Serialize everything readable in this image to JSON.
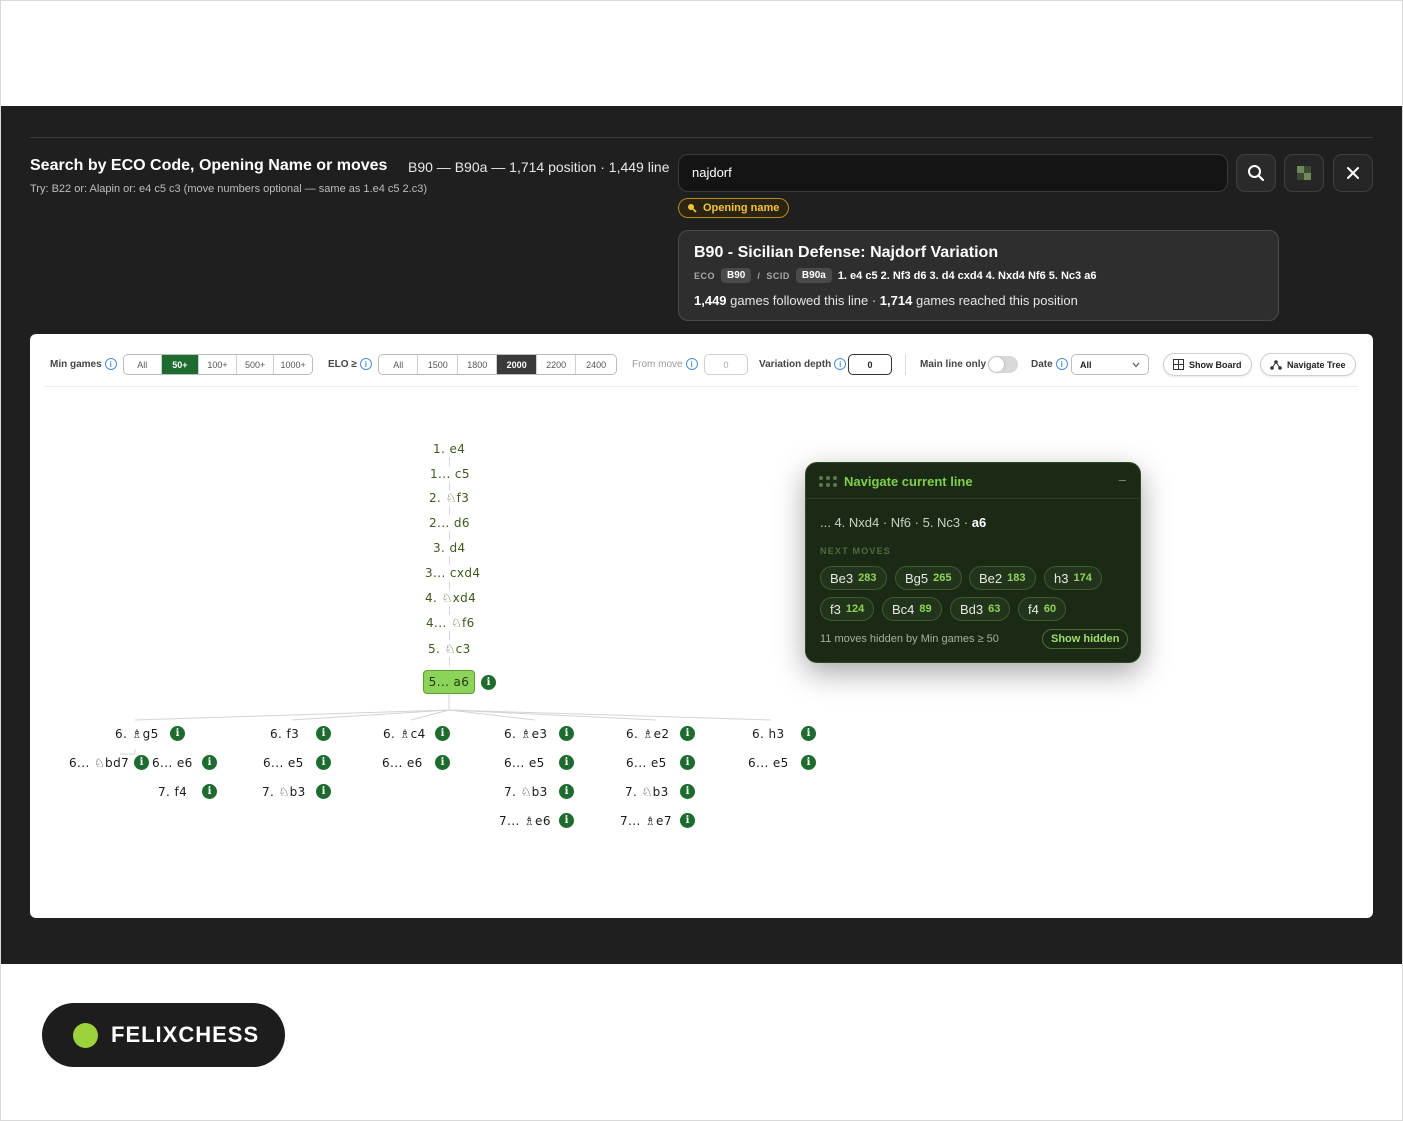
{
  "search": {
    "title": "Search by ECO Code, Opening Name or moves",
    "hint": "Try: B22 or: Alapin or: e4 c5 c3 (move numbers optional — same as 1.e4 c5 2.c3)",
    "summary": "B90 — B90a — 1,714 position · 1,449 line",
    "query": "najdorf",
    "mode_badge": "Opening name",
    "buttons": {
      "search_icon": "search-icon",
      "board_icon": "board-icon",
      "close_icon": "close-icon"
    }
  },
  "result": {
    "name": "B90 - Sicilian Defense: Najdorf Variation",
    "eco_label": "ECO",
    "eco": "B90",
    "sep": "/",
    "scid_label": "SCID",
    "scid": "B90a",
    "moves": "1. e4 c5 2. Nf3 d6 3. d4 cxd4 4. Nxd4 Nf6 5. Nc3 a6",
    "followed_count": "1,449",
    "followed_text": "games followed this line",
    "reached_count": "1,714",
    "reached_text": "games reached this position",
    "stat_sep": "·"
  },
  "toolbar": {
    "min_games_label": "Min games",
    "min_games_options": [
      "All",
      "50+",
      "100+",
      "500+",
      "1000+"
    ],
    "min_games_selected": "50+",
    "elo_label": "ELO ≥",
    "elo_options": [
      "All",
      "1500",
      "1800",
      "2000",
      "2200",
      "2400"
    ],
    "elo_selected": "2000",
    "from_move_label": "From move",
    "from_move_value": "0",
    "variation_depth_label": "Variation depth",
    "variation_depth_value": "0",
    "main_line_label": "Main line only",
    "main_line_on": false,
    "date_label": "Date",
    "date_value": "All",
    "show_board_label": "Show Board",
    "navigate_tree_label": "Navigate Tree"
  },
  "tree": {
    "main_line": [
      "1. e4",
      "1... c5",
      "2. ♘f3",
      "2... d6",
      "3. d4",
      "3... cxd4",
      "4. ♘xd4",
      "4... ♘f6",
      "5. ♘c3"
    ],
    "current": "5... a6",
    "branches": [
      {
        "move": "6. ♗g5",
        "replies": [
          "6... ♘bd7",
          "6... e6",
          "7. f4"
        ]
      },
      {
        "move": "6. f3",
        "replies": [
          "6... e5",
          "7. ♘b3"
        ]
      },
      {
        "move": "6. ♗c4",
        "replies": [
          "6... e6"
        ]
      },
      {
        "move": "6. ♗e3",
        "replies": [
          "6... e5",
          "7. ♘b3",
          "7... ♗e6"
        ]
      },
      {
        "move": "6. ♗e2",
        "replies": [
          "6... e5",
          "7. ♘b3",
          "7... ♗e7"
        ]
      },
      {
        "move": "6. h3",
        "replies": [
          "6... e5"
        ]
      }
    ],
    "info_glyph": "i"
  },
  "navigator": {
    "title": "Navigate current line",
    "collapse": "–",
    "line_prefix": "... 4. Nxd4 · Nf6 · 5. Nc3 ·",
    "line_current": "a6",
    "next_label": "NEXT MOVES",
    "next_moves": [
      {
        "move": "Be3",
        "count": "283"
      },
      {
        "move": "Bg5",
        "count": "265"
      },
      {
        "move": "Be2",
        "count": "183"
      },
      {
        "move": "h3",
        "count": "174"
      },
      {
        "move": "f3",
        "count": "124"
      },
      {
        "move": "Bc4",
        "count": "89"
      },
      {
        "move": "Bd3",
        "count": "63"
      },
      {
        "move": "f4",
        "count": "60"
      }
    ],
    "hidden_note": "11 moves hidden by Min games ≥ 50",
    "show_hidden_label": "Show hidden"
  },
  "brand": {
    "name": "FELIXCHESS",
    "dot_color": "#9cd23c"
  },
  "colors": {
    "accent_green": "#1d6b2e",
    "current_node": "#8cd35a",
    "badge_gold": "#f2c437"
  }
}
